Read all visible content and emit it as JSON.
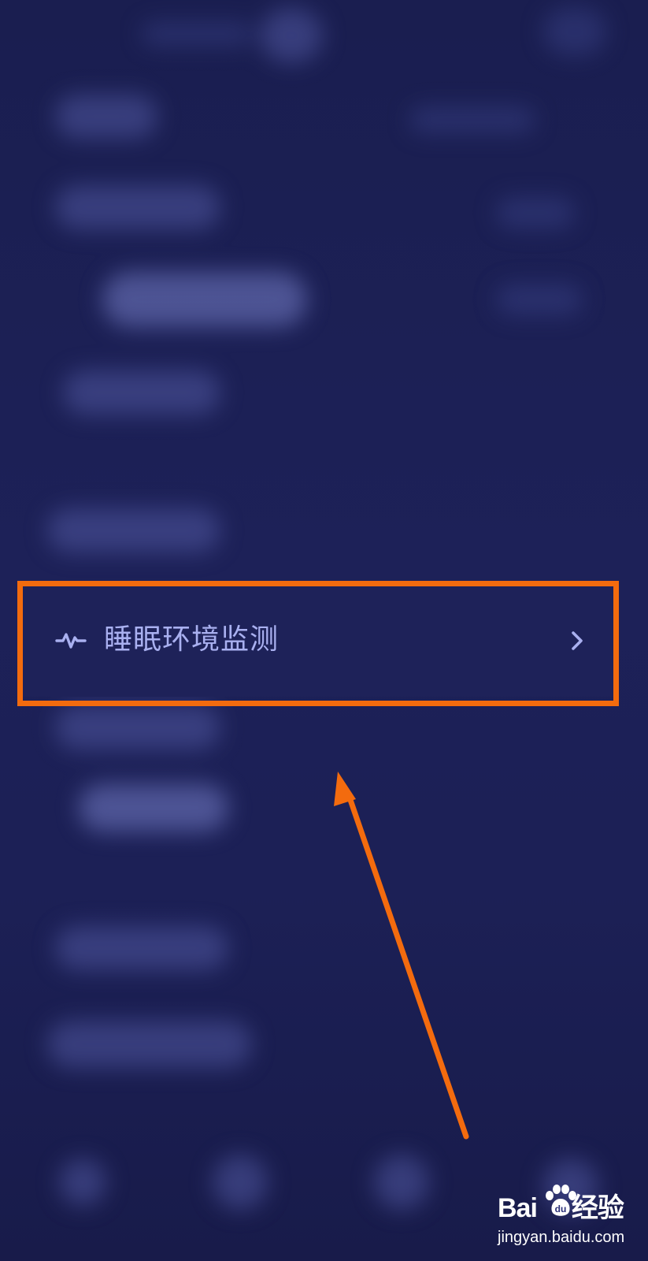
{
  "menu": {
    "item_label": "睡眠环境监测",
    "icon": "heartbeat-icon",
    "chevron": "chevron-right-icon"
  },
  "annotation": {
    "highlight_color": "#f36b0e",
    "arrow_color": "#f36b0e"
  },
  "watermark": {
    "logo_text_left": "Bai",
    "logo_text_right": "经验",
    "logo_du": "du",
    "url": "jingyan.baidu.com"
  },
  "colors": {
    "background": "#1b1f52",
    "row_background": "#1e2259",
    "label": "#a9b0f0"
  }
}
